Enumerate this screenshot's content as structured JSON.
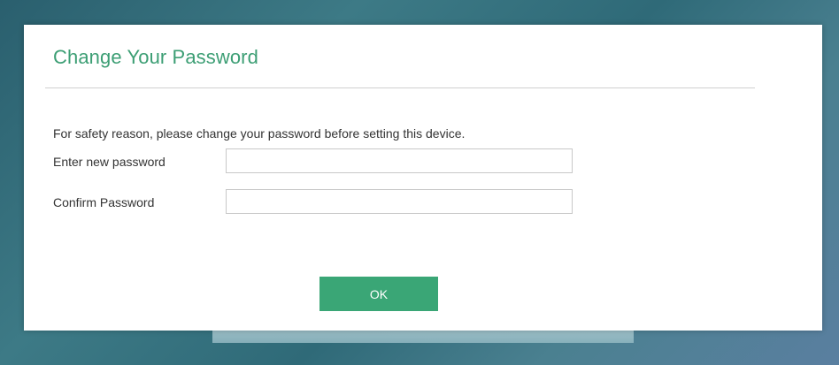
{
  "dialog": {
    "title": "Change Your Password",
    "notice": "For safety reason, please change your password before setting this device.",
    "fields": {
      "new_password": {
        "label": "Enter new password",
        "value": "",
        "placeholder": ""
      },
      "confirm_password": {
        "label": "Confirm Password",
        "value": "",
        "placeholder": ""
      }
    },
    "ok_label": "OK"
  },
  "colors": {
    "title": "#3c9e74",
    "button": "#3aa676",
    "divider": "#cfcfcf"
  }
}
